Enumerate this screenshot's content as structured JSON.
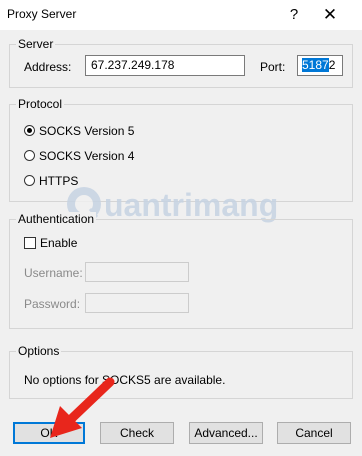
{
  "window": {
    "title": "Proxy Server",
    "help_glyph": "?",
    "close_glyph": "✕"
  },
  "server": {
    "group_label": "Server",
    "address_label": "Address:",
    "address_value": "67.237.249.178",
    "port_label": "Port:",
    "port_value_selected": "5187",
    "port_value_rest": "2"
  },
  "protocol": {
    "group_label": "Protocol",
    "options": [
      {
        "label": "SOCKS Version 5",
        "selected": true
      },
      {
        "label": "SOCKS Version 4",
        "selected": false
      },
      {
        "label": "HTTPS",
        "selected": false
      }
    ]
  },
  "authentication": {
    "group_label": "Authentication",
    "enable_label": "Enable",
    "enable_checked": false,
    "username_label": "Username:",
    "password_label": "Password:"
  },
  "options": {
    "group_label": "Options",
    "message": "No options for SOCKS5 are available."
  },
  "buttons": {
    "ok": "OK",
    "check": "Check",
    "advanced": "Advanced...",
    "cancel": "Cancel"
  },
  "watermark": {
    "text": "uantrimang",
    "color": "#c6d3e3"
  },
  "colors": {
    "selection": "#0078d7",
    "arrow": "#e8261c",
    "default_button_border": "#0078d7"
  }
}
